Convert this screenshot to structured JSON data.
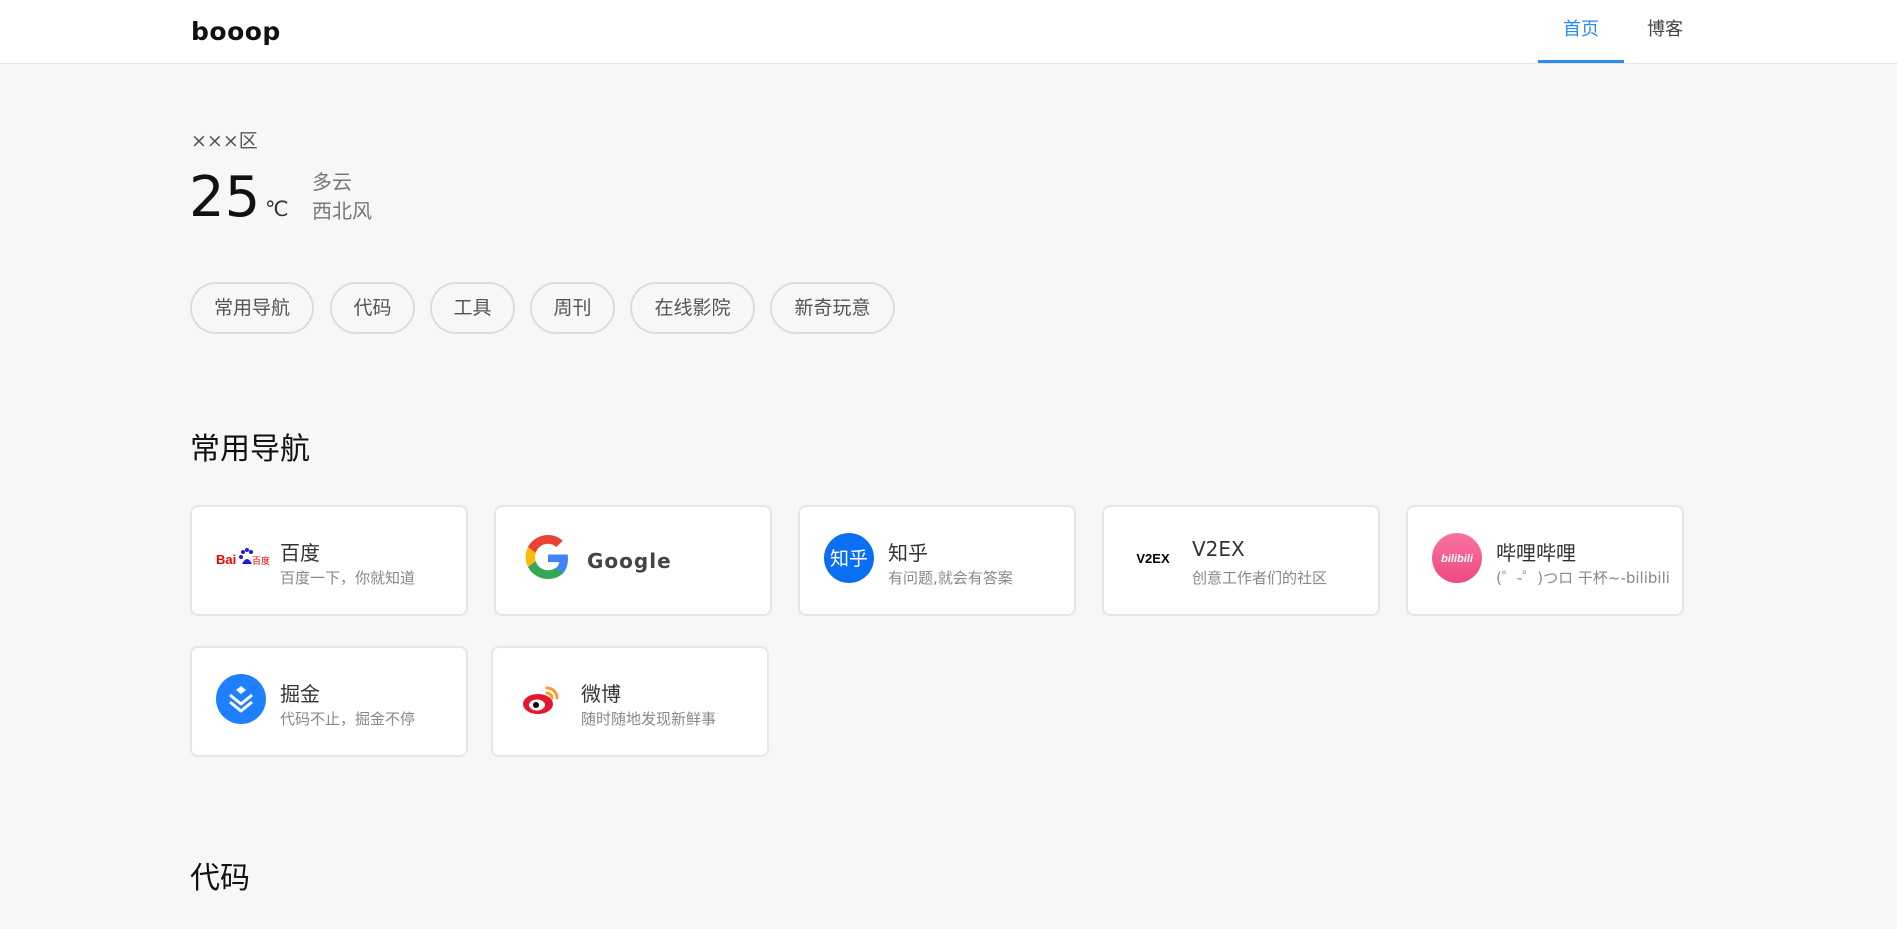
{
  "header": {
    "logo": "booop",
    "nav": [
      {
        "label": "首页",
        "active": true
      },
      {
        "label": "博客",
        "active": false
      }
    ],
    "accent_color": "#2a8bf2"
  },
  "weather": {
    "location": "×××区",
    "temperature": "25",
    "unit": "℃",
    "condition": "多云",
    "wind": "西北风"
  },
  "tags": [
    "常用导航",
    "代码",
    "工具",
    "周刊",
    "在线影院",
    "新奇玩意"
  ],
  "sections": [
    {
      "title": "常用导航",
      "cards": [
        {
          "name": "百度",
          "desc": "百度一下，你就知道",
          "icon": "baidu-logo-icon",
          "icon_text": "Bai百度"
        },
        {
          "name": "Google",
          "desc": "",
          "icon": "google-logo-icon"
        },
        {
          "name": "知乎",
          "desc": "有问题,就会有答案",
          "icon": "zhihu-logo-icon",
          "icon_text": "知乎"
        },
        {
          "name": "V2EX",
          "desc": "创意工作者们的社区",
          "icon": "v2ex-logo-icon",
          "icon_text": "V2EX"
        },
        {
          "name": "哔哩哔哩",
          "desc": "(゜-゜)つロ 干杯~-bilibili",
          "icon": "bilibili-logo-icon",
          "icon_text": "bilibili"
        },
        {
          "name": "掘金",
          "desc": "代码不止，掘金不停",
          "icon": "juejin-logo-icon"
        },
        {
          "name": "微博",
          "desc": "随时随地发现新鲜事",
          "icon": "weibo-logo-icon"
        }
      ]
    },
    {
      "title": "代码",
      "cards": []
    }
  ]
}
